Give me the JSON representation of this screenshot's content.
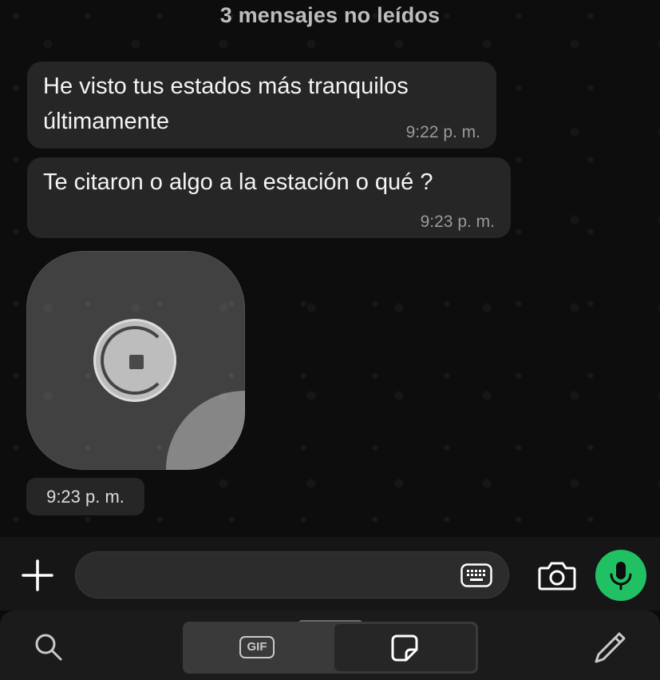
{
  "banner": {
    "unread_text": "3 mensajes no leídos"
  },
  "messages": [
    {
      "text_line1": "He visto tus estados más tranquilos",
      "text_line2": "últimamente",
      "time": "9:22 p. m."
    },
    {
      "text_line1": "Te citaron o algo a la estación o qué ?",
      "time": "9:23 p. m."
    }
  ],
  "sticker_message": {
    "time": "9:23 p. m.",
    "stop_icon": "stop-icon"
  },
  "composer": {
    "attach_icon": "plus-icon",
    "input_value": "",
    "keyboard_icon": "keyboard-icon",
    "camera_icon": "camera-icon",
    "mic_icon": "mic-icon",
    "accent_color": "#21c063"
  },
  "picker": {
    "search_icon": "search-icon",
    "gif_tab_label": "GIF",
    "sticker_tab_icon": "sticker-icon",
    "edit_icon": "pencil-icon",
    "selected_tab": "sticker"
  }
}
